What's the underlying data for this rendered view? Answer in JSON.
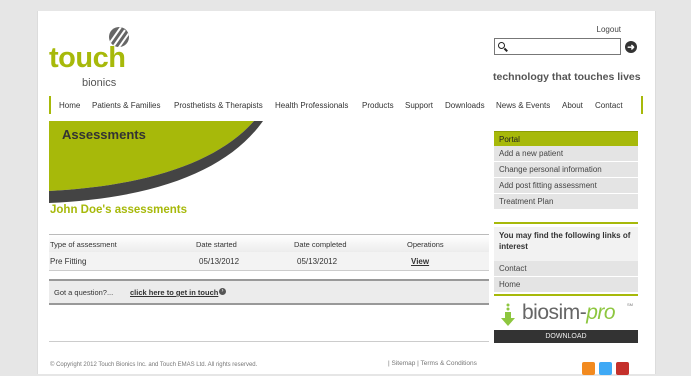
{
  "header": {
    "logo_main": "touch",
    "logo_sub": "bionics",
    "logout_label": "Logout",
    "search_value": "",
    "search_icon": "search-icon",
    "go_icon": "arrow-right-circle-icon",
    "tagline": "technology that touches lives"
  },
  "nav": {
    "items": [
      "Home",
      "Patients & Families",
      "Prosthetists & Therapists",
      "Health Professionals",
      "Products",
      "Support",
      "Downloads",
      "News & Events",
      "About",
      "Contact"
    ]
  },
  "main": {
    "banner_title": "Assessments",
    "heading": "John Doe's assessments",
    "table": {
      "headers": [
        "Type of assessment",
        "Date started",
        "Date completed",
        "Operations"
      ],
      "rows": [
        [
          "Pre Fitting",
          "05/13/2012",
          "05/13/2012",
          "View"
        ]
      ]
    },
    "question_text": "Got a question?...",
    "question_link": "click here to get in touch"
  },
  "sidebar": {
    "portal_title": "Portal",
    "portal_items": [
      "Add a new patient",
      "Change personal information",
      "Add post fitting assessment",
      "Treatment Plan"
    ],
    "interest_title": "You may find the following links of interest",
    "interest_items": [
      "Contact",
      "Home"
    ],
    "biosim_name": "biosim",
    "biosim_suffix": "pro",
    "biosim_mark": "SM",
    "biosim_download": "DOWNLOAD"
  },
  "footer": {
    "copyright": "© Copyright 2012 Touch Bionics Inc. and Touch EMAS Ltd. All rights reserved.",
    "links": "|  Sitemap  |  Terms & Conditions",
    "social_icons": [
      "rss-icon",
      "twitter-icon",
      "youtube-icon"
    ]
  },
  "colors": {
    "brand_green": "#a7b90a",
    "biosim_green": "#8dc63f",
    "dark": "#333333"
  }
}
